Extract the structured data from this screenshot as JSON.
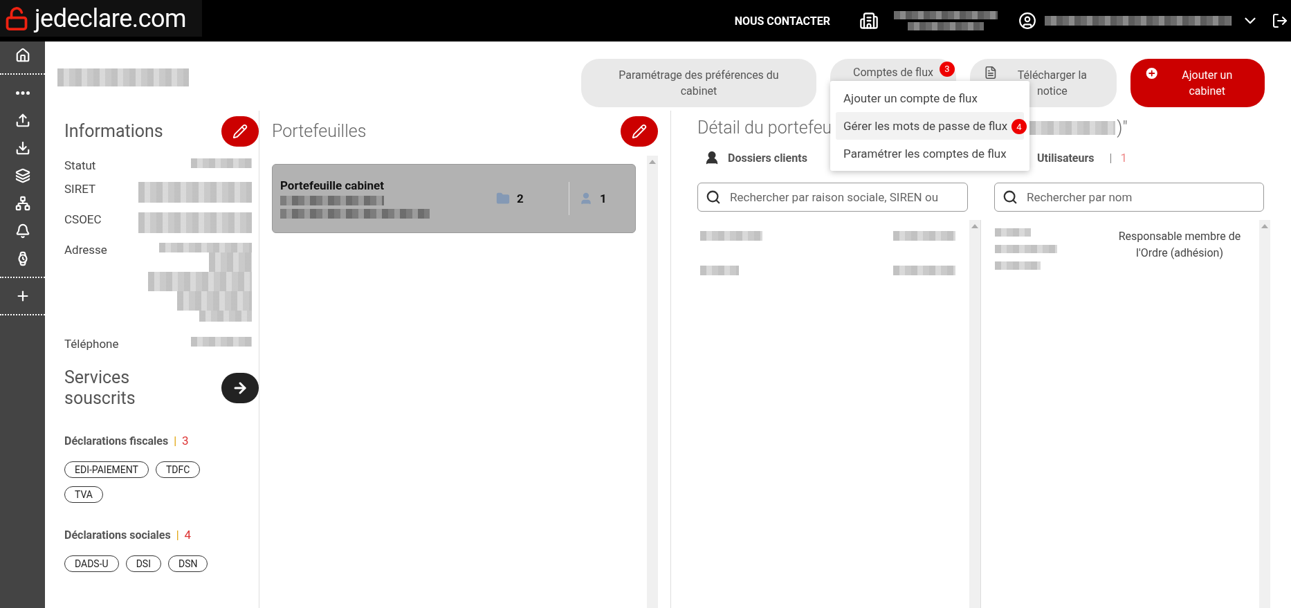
{
  "header": {
    "logo_text": "jedeclare.com",
    "contact_link": "NOUS CONTACTER"
  },
  "toolbar": {
    "buttons": [
      {
        "label": "Paramétrage des préférences du cabinet",
        "kind": "plain"
      },
      {
        "label": "Comptes de flux",
        "kind": "dropdown",
        "badge": "3",
        "expanded": true
      },
      {
        "label": "Télécharger la notice",
        "kind": "pdf"
      },
      {
        "label": "Ajouter un cabinet",
        "kind": "primary"
      }
    ]
  },
  "flux_menu": {
    "items": [
      {
        "label": "Ajouter un compte de flux",
        "selected": false
      },
      {
        "label": "Gérer les mots de passe de flux",
        "selected": true,
        "badge": "4"
      },
      {
        "label": "Paramétrer les comptes de flux",
        "selected": false
      }
    ]
  },
  "informations": {
    "title": "Informations",
    "fields": [
      {
        "label": "Statut",
        "kind": "short"
      },
      {
        "label": "SIRET",
        "kind": "double"
      },
      {
        "label": "CSOEC",
        "kind": "double"
      },
      {
        "label": "Adresse",
        "kind": "address"
      },
      {
        "label": "Téléphone",
        "kind": "short"
      }
    ]
  },
  "services": {
    "title": "Services souscrits",
    "groups": [
      {
        "title": "Déclarations fiscales",
        "separator": "|",
        "count": "3",
        "tags": [
          "EDI-PAIEMENT",
          "TDFC",
          "TVA"
        ]
      },
      {
        "title": "Déclarations sociales",
        "separator": "|",
        "count": "4",
        "tags": [
          "DADS-U",
          "DSI",
          "DSN"
        ]
      }
    ]
  },
  "portefeuilles": {
    "title": "Portefeuilles",
    "cards": [
      {
        "name": "Portefeuille cabinet",
        "dossiers": "2",
        "utilisateurs": "1",
        "selected": true
      }
    ]
  },
  "detail": {
    "title": "Détail du portefeu",
    "title_end": ")\"",
    "clients": {
      "title": "Dossiers clients",
      "search_placeholder": "Rechercher par raison sociale, SIREN ou"
    },
    "users": {
      "title": "Utilisateurs",
      "separator": "|",
      "count": "1",
      "search_placeholder": "Rechercher par nom",
      "rows": [
        {
          "role": "Responsable membre de l'Ordre (adhésion)"
        }
      ]
    }
  }
}
